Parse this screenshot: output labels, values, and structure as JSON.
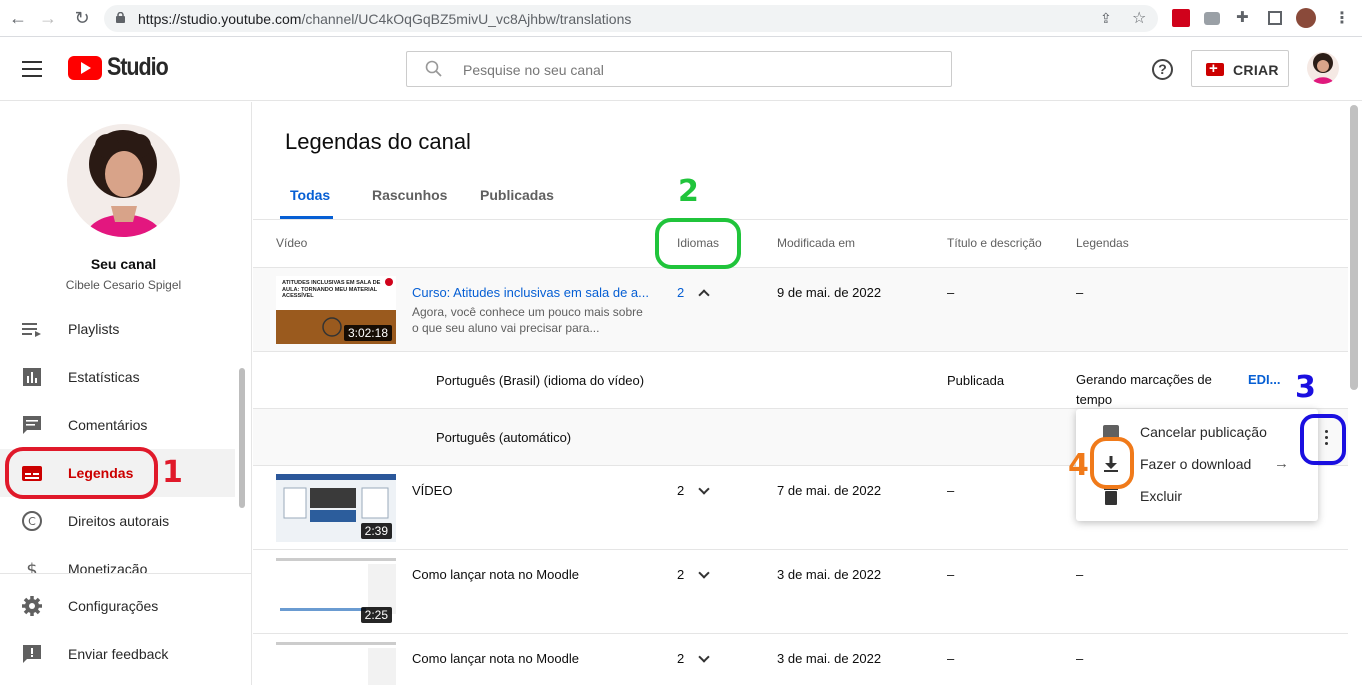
{
  "browser": {
    "url_host": "https://studio.youtube.com",
    "url_path": "/channel/UC4kOqGqBZ5mivU_vc8Ajhbw/translations"
  },
  "header": {
    "logo_text": "Studio",
    "search_placeholder": "Pesquise no seu canal",
    "help_label": "?",
    "create_label": "CRIAR"
  },
  "sidebar": {
    "channel_title": "Seu canal",
    "channel_name": "Cibele Cesario Spigel",
    "items": [
      {
        "label": "Playlists",
        "icon": "playlists-icon"
      },
      {
        "label": "Estatísticas",
        "icon": "analytics-icon"
      },
      {
        "label": "Comentários",
        "icon": "comments-icon"
      },
      {
        "label": "Legendas",
        "icon": "subtitles-icon",
        "active": true
      },
      {
        "label": "Direitos autorais",
        "icon": "copyright-icon"
      },
      {
        "label": "Monetização",
        "icon": "monetization-icon"
      }
    ],
    "bottom_items": [
      {
        "label": "Configurações",
        "icon": "gear-icon"
      },
      {
        "label": "Enviar feedback",
        "icon": "feedback-icon"
      }
    ]
  },
  "main": {
    "title": "Legendas do canal",
    "tabs": [
      "Todas",
      "Rascunhos",
      "Publicadas"
    ],
    "columns": {
      "video": "Vídeo",
      "languages": "Idiomas",
      "modified": "Modificada em",
      "title_desc": "Título e descrição",
      "subtitles": "Legendas"
    },
    "rows": [
      {
        "title": "Curso: Atitudes inclusivas em sala de a...",
        "description": "Agora, você conhece um pouco mais sobre o que seu aluno vai precisar para...",
        "thumb_text": "ATITUDES INCLUSIVAS EM SALA DE AULA: TORNANDO MEU MATERIAL ACESSÍVEL",
        "duration": "3:02:18",
        "langs": "2",
        "modified": "9 de mai. de 2022",
        "title_desc": "–",
        "subtitles": "–"
      },
      {
        "title": "VÍDEO",
        "duration": "2:39",
        "langs": "2",
        "modified": "7 de mai. de 2022",
        "title_desc": "–",
        "subtitles": "–"
      },
      {
        "title": "Como lançar nota no Moodle",
        "duration": "2:25",
        "langs": "2",
        "modified": "3 de mai. de 2022",
        "title_desc": "–",
        "subtitles": "–"
      },
      {
        "title": "Como lançar nota no Moodle",
        "langs": "2",
        "modified": "3 de mai. de 2022",
        "title_desc": "–",
        "subtitles": "–"
      }
    ],
    "sub_rows": [
      {
        "language": "Português (Brasil) (idioma do vídeo)",
        "title_desc": "Publicada",
        "subtitles": "Gerando marcações de tempo",
        "action": "EDI..."
      },
      {
        "language": "Português (automático)"
      }
    ]
  },
  "menu": {
    "items": [
      "Cancelar publicação",
      "Fazer o download",
      "Excluir"
    ],
    "submenu_arrow": "→"
  },
  "annotations": {
    "n1": "1",
    "n2": "2",
    "n3": "3",
    "n4": "4",
    "colors": {
      "red": "#e0192a",
      "green": "#20c43b",
      "blue": "#1a0fe0",
      "orange": "#f07a1a"
    }
  }
}
